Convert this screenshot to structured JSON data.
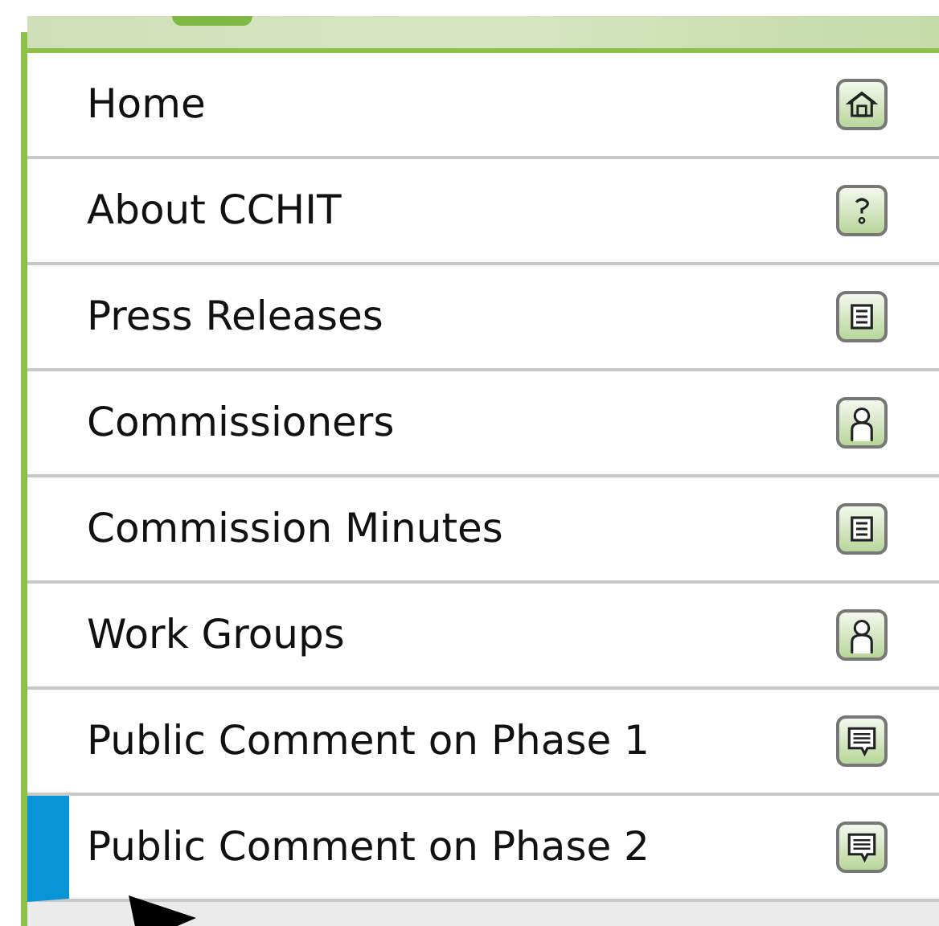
{
  "menu": {
    "items": [
      {
        "label": "Home",
        "selected": false
      },
      {
        "label": "About CCHIT",
        "selected": false
      },
      {
        "label": "Press Releases",
        "selected": false
      },
      {
        "label": "Commissioners",
        "selected": false
      },
      {
        "label": "Commission Minutes",
        "selected": false
      },
      {
        "label": "Work Groups",
        "selected": false
      },
      {
        "label": "Public Comment on Phase 1",
        "selected": false
      },
      {
        "label": "Public Comment on Phase 2",
        "selected": true
      }
    ]
  }
}
